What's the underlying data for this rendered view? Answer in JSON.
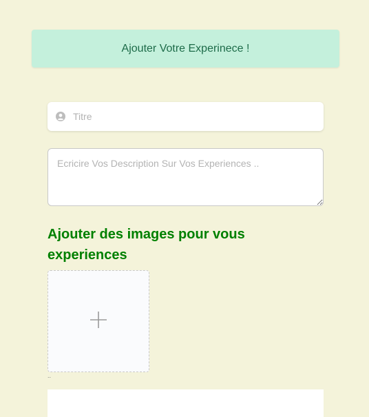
{
  "banner": {
    "text": "Ajouter Votre Experinece !"
  },
  "title_field": {
    "icon": "user-circle-icon",
    "value": "",
    "placeholder": "Titre"
  },
  "description_field": {
    "value": "",
    "placeholder": "Ecricire Vos Description Sur Vos Experiences .."
  },
  "images_section": {
    "heading": "Ajouter des images pour vous experiences",
    "upload_icon": "plus-icon",
    "caption": ".."
  },
  "colors": {
    "background": "#f4f3da",
    "banner_bg": "#c4f0dc",
    "banner_text": "#1d6b49",
    "heading": "#008000"
  }
}
